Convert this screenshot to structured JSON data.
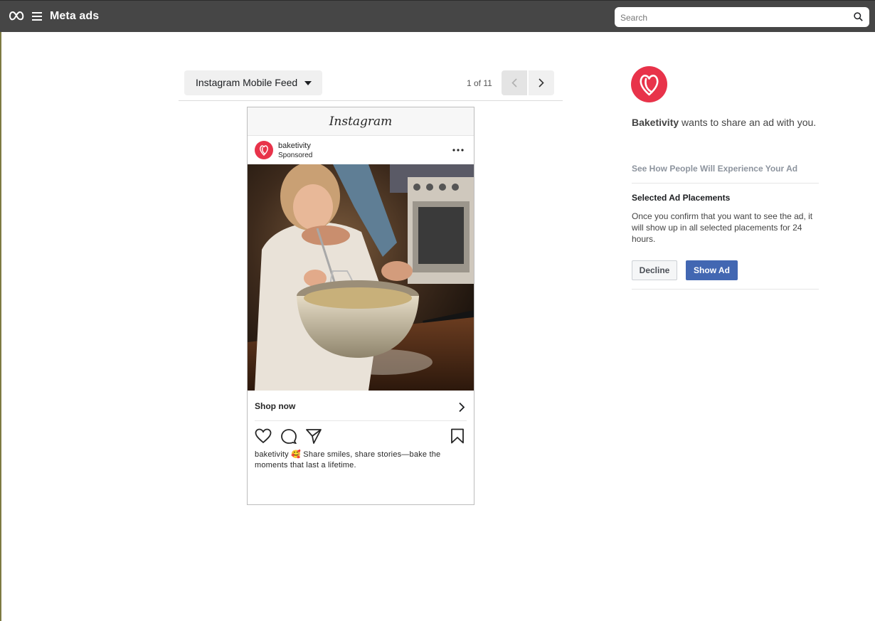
{
  "topbar": {
    "title": "Meta ads",
    "search_placeholder": "Search"
  },
  "preview": {
    "placement_label": "Instagram Mobile Feed",
    "pager_text": "1 of 11"
  },
  "post": {
    "app_name": "Instagram",
    "account": "baketivity",
    "sponsored": "Sponsored",
    "cta": "Shop now",
    "caption_account": "baketivity",
    "caption_text": "🥰 Share smiles, share stories—bake the moments that last a lifetime."
  },
  "panel": {
    "advertiser": "Baketivity",
    "share_text": " wants to share an ad with you.",
    "see_how": "See How People Will Experience Your Ad",
    "selected_title": "Selected Ad Placements",
    "selected_desc": "Once you confirm that you want to see the ad, it will show up in all selected placements for 24 hours.",
    "decline_label": "Decline",
    "show_label": "Show Ad"
  },
  "colors": {
    "topbar": "#464646",
    "brand_red": "#e8334a",
    "primary_button": "#4267b2"
  },
  "icons": {
    "meta": "meta-infinity-icon",
    "menu": "hamburger-icon",
    "search": "search-icon",
    "prev": "chevron-left-icon",
    "next": "chevron-right-icon",
    "like": "heart-icon",
    "comment": "comment-icon",
    "share": "paper-plane-icon",
    "save": "bookmark-icon"
  }
}
